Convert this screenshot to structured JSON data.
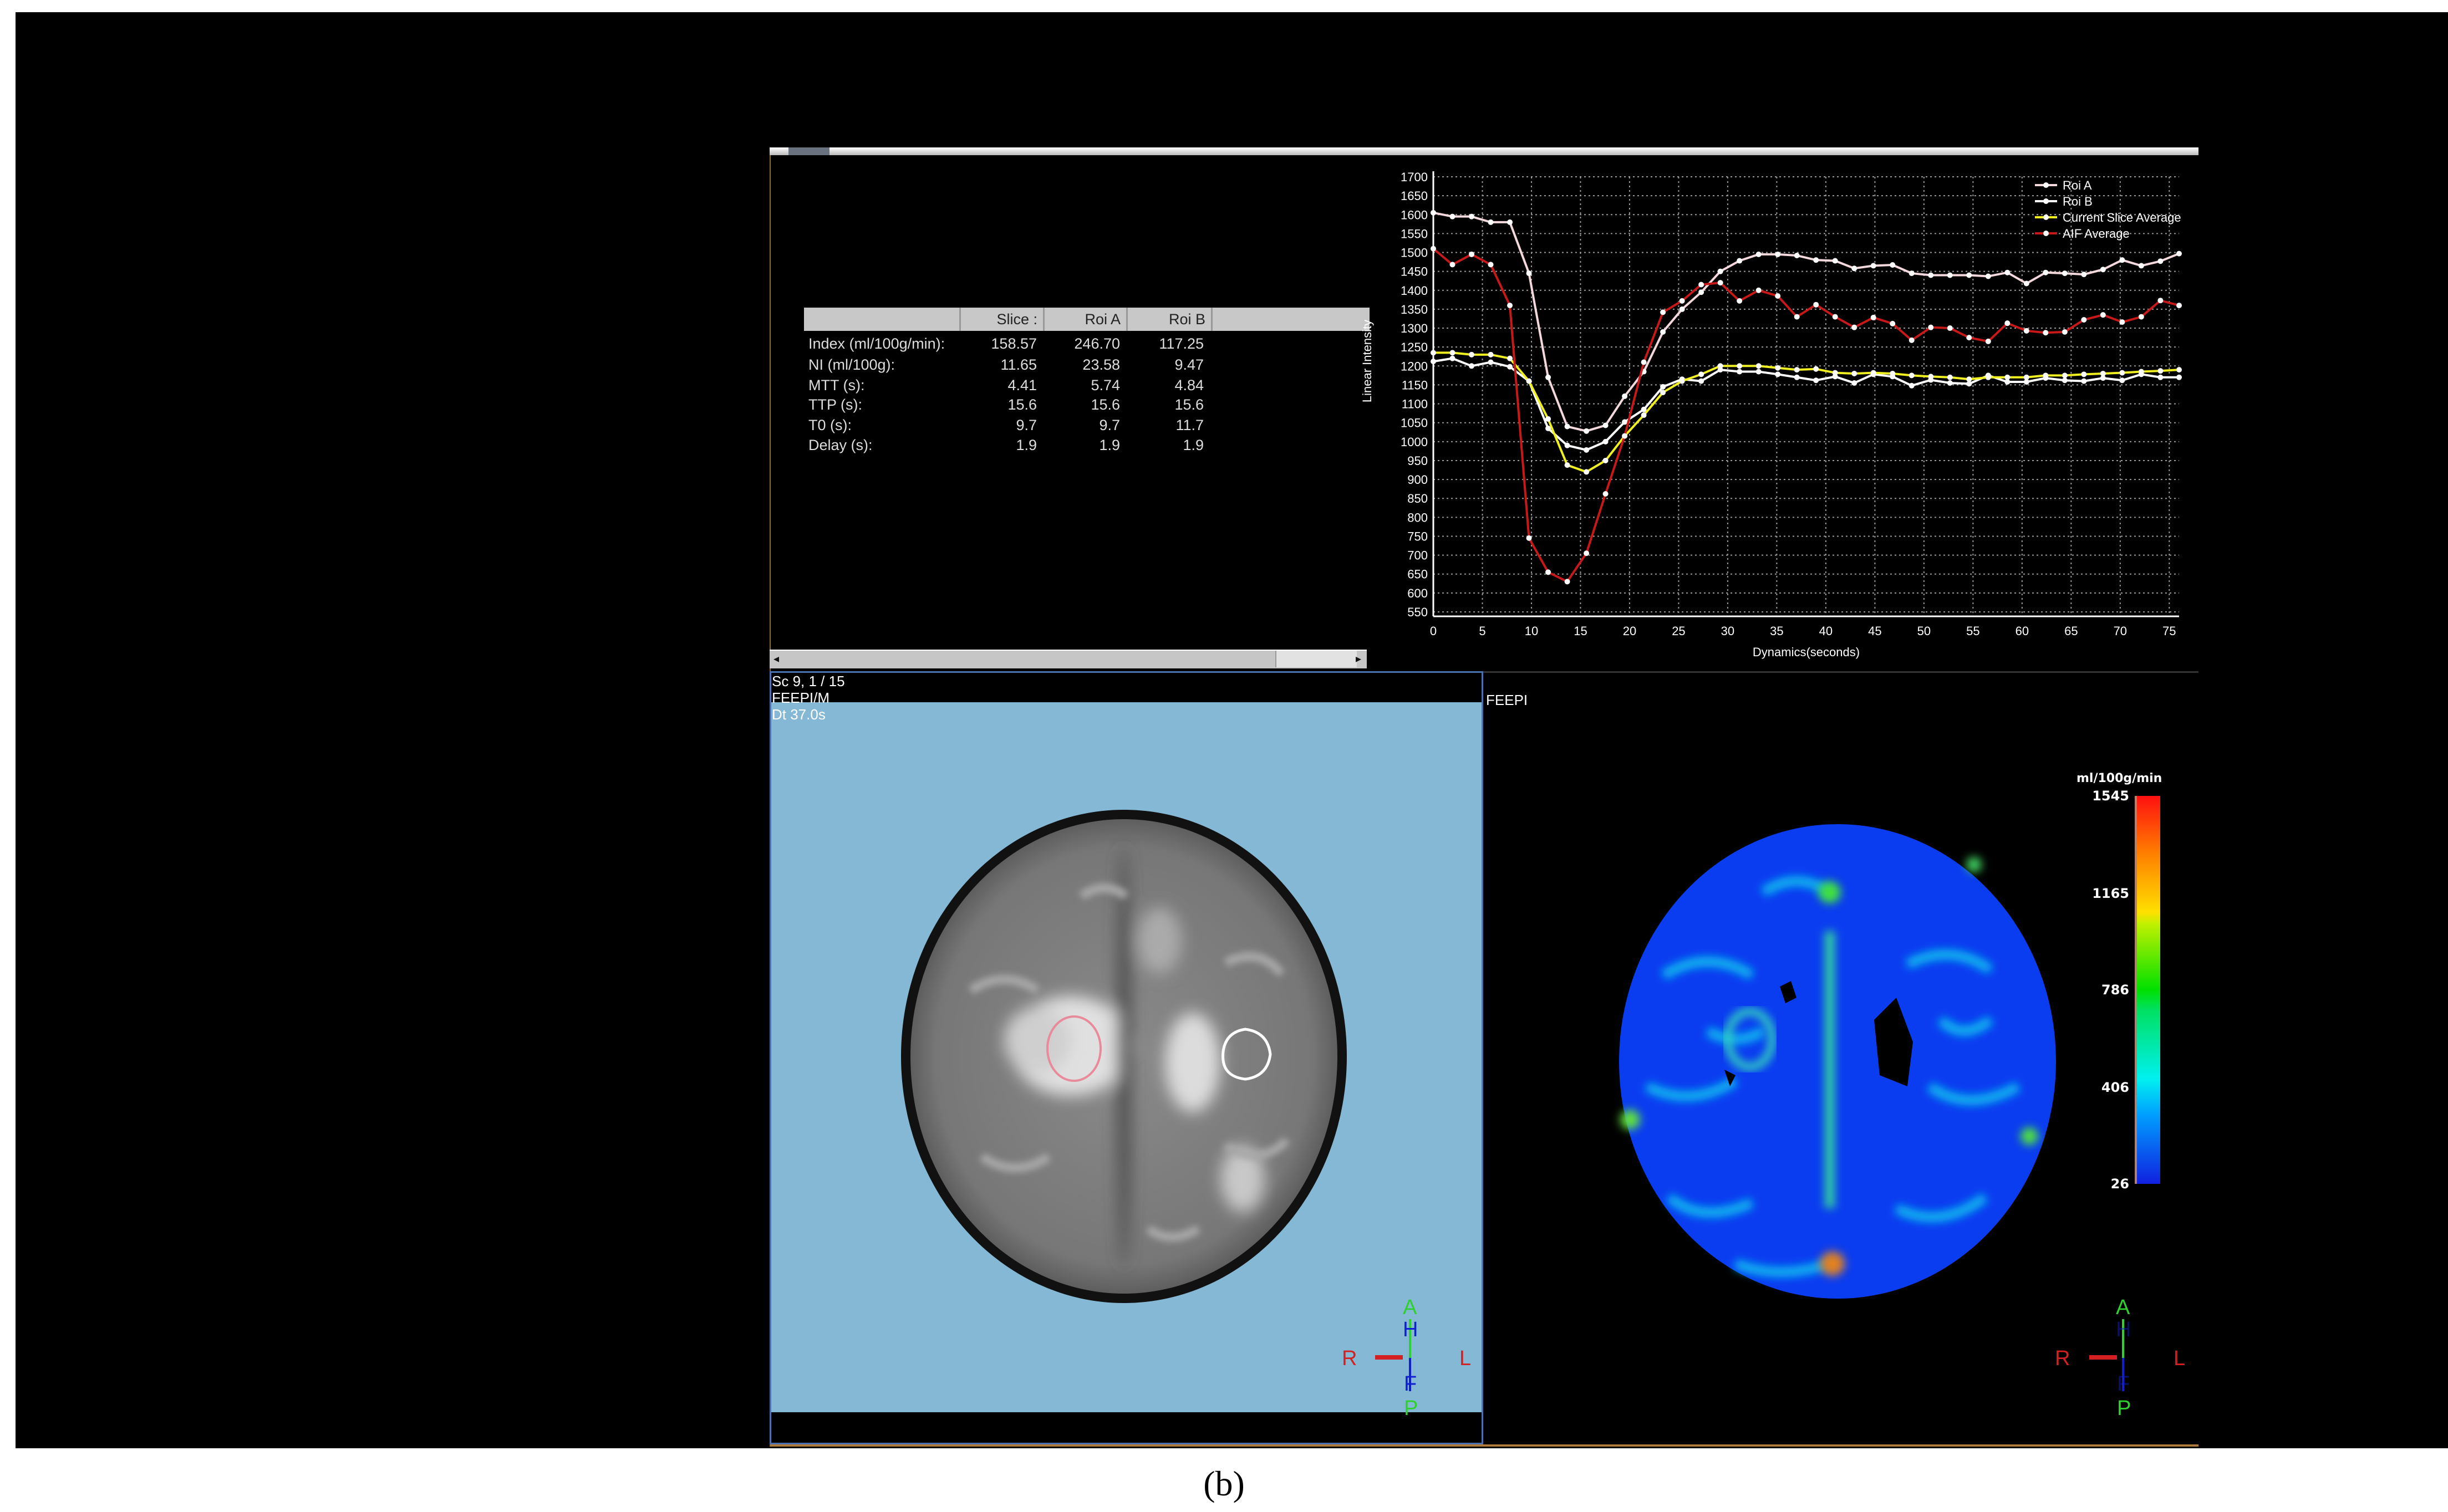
{
  "caption": "(b)",
  "table": {
    "headers": [
      "",
      "Slice :",
      "Roi A",
      "Roi B"
    ],
    "rows": [
      {
        "label": "Index (ml/100g/min):",
        "slice": "158.57",
        "roi_a": "246.70",
        "roi_b": "117.25"
      },
      {
        "label": "NI (ml/100g):",
        "slice": "11.65",
        "roi_a": "23.58",
        "roi_b": "9.47"
      },
      {
        "label": "MTT (s):",
        "slice": "4.41",
        "roi_a": "5.74",
        "roi_b": "4.84"
      },
      {
        "label": "TTP (s):",
        "slice": "15.6",
        "roi_a": "15.6",
        "roi_b": "15.6"
      },
      {
        "label": "T0 (s):",
        "slice": "9.7",
        "roi_a": "9.7",
        "roi_b": "11.7"
      },
      {
        "label": "Delay (s):",
        "slice": "1.9",
        "roi_a": "1.9",
        "roi_b": "1.9"
      }
    ]
  },
  "scrollbar": {
    "left_arrow": "◂",
    "right_arrow": "▸"
  },
  "left_viewport": {
    "line1": "Sc 9, 1 / 15",
    "line2": "FEEPI/M",
    "line3": "Dt 37.0s",
    "orientation": {
      "top": "A",
      "top2": "H",
      "left": "R",
      "right": "L",
      "bottom2": "F",
      "bottom": "P"
    }
  },
  "right_viewport": {
    "line1": "FEEPI",
    "orientation": {
      "top": "A",
      "top2": "H",
      "left": "R",
      "right": "L",
      "bottom2": "F",
      "bottom": "P"
    },
    "colorbar": {
      "title": "ml/100g/min",
      "ticks": [
        "1545",
        "1165",
        "786",
        "406",
        "26"
      ],
      "min": 26,
      "max": 1545
    }
  },
  "chart_data": {
    "type": "line",
    "xlabel": "Dynamics(seconds)",
    "ylabel": "Linear Intensity",
    "xlim": [
      0,
      76
    ],
    "ylim": [
      550,
      1700
    ],
    "xticks": [
      0,
      5,
      10,
      15,
      20,
      25,
      30,
      35,
      40,
      45,
      50,
      55,
      60,
      65,
      70,
      75
    ],
    "yticks": [
      550,
      600,
      650,
      700,
      750,
      800,
      850,
      900,
      950,
      1000,
      1050,
      1100,
      1150,
      1200,
      1250,
      1300,
      1350,
      1400,
      1450,
      1500,
      1550,
      1600,
      1650,
      1700
    ],
    "grid": true,
    "legend_position": "top-right",
    "x_step": 1.95,
    "series": [
      {
        "name": "Roi A",
        "color": "#f4d8dc",
        "values": [
          1605,
          1595,
          1595,
          1580,
          1580,
          1445,
          1170,
          1040,
          1028,
          1043,
          1120,
          1185,
          1290,
          1350,
          1395,
          1450,
          1478,
          1495,
          1495,
          1492,
          1480,
          1478,
          1458,
          1465,
          1467,
          1445,
          1440,
          1440,
          1440,
          1437,
          1447,
          1418,
          1447,
          1445,
          1442,
          1455,
          1480,
          1465,
          1477,
          1497
        ]
      },
      {
        "name": "Roi B",
        "color": "#ffffff",
        "values": [
          1212,
          1220,
          1200,
          1210,
          1198,
          1160,
          1035,
          990,
          978,
          1000,
          1052,
          1085,
          1145,
          1165,
          1160,
          1190,
          1185,
          1185,
          1178,
          1170,
          1162,
          1172,
          1155,
          1178,
          1172,
          1148,
          1163,
          1155,
          1153,
          1175,
          1158,
          1158,
          1168,
          1162,
          1160,
          1168,
          1162,
          1178,
          1170,
          1170
        ]
      },
      {
        "name": "Current Slice Average",
        "color": "#f0f020",
        "values": [
          1235,
          1235,
          1230,
          1230,
          1220,
          1160,
          1060,
          938,
          920,
          950,
          1015,
          1070,
          1130,
          1160,
          1178,
          1200,
          1200,
          1200,
          1195,
          1190,
          1192,
          1182,
          1180,
          1182,
          1180,
          1175,
          1172,
          1170,
          1165,
          1170,
          1170,
          1170,
          1175,
          1175,
          1178,
          1180,
          1182,
          1185,
          1187,
          1190
        ]
      },
      {
        "name": "AIF Average",
        "color": "#c81818",
        "values": [
          1510,
          1468,
          1495,
          1468,
          1360,
          745,
          655,
          630,
          705,
          862,
          1015,
          1210,
          1342,
          1372,
          1415,
          1420,
          1372,
          1400,
          1385,
          1330,
          1362,
          1330,
          1302,
          1328,
          1312,
          1268,
          1302,
          1300,
          1275,
          1265,
          1313,
          1293,
          1288,
          1290,
          1322,
          1335,
          1316,
          1330,
          1373,
          1360
        ]
      }
    ]
  }
}
